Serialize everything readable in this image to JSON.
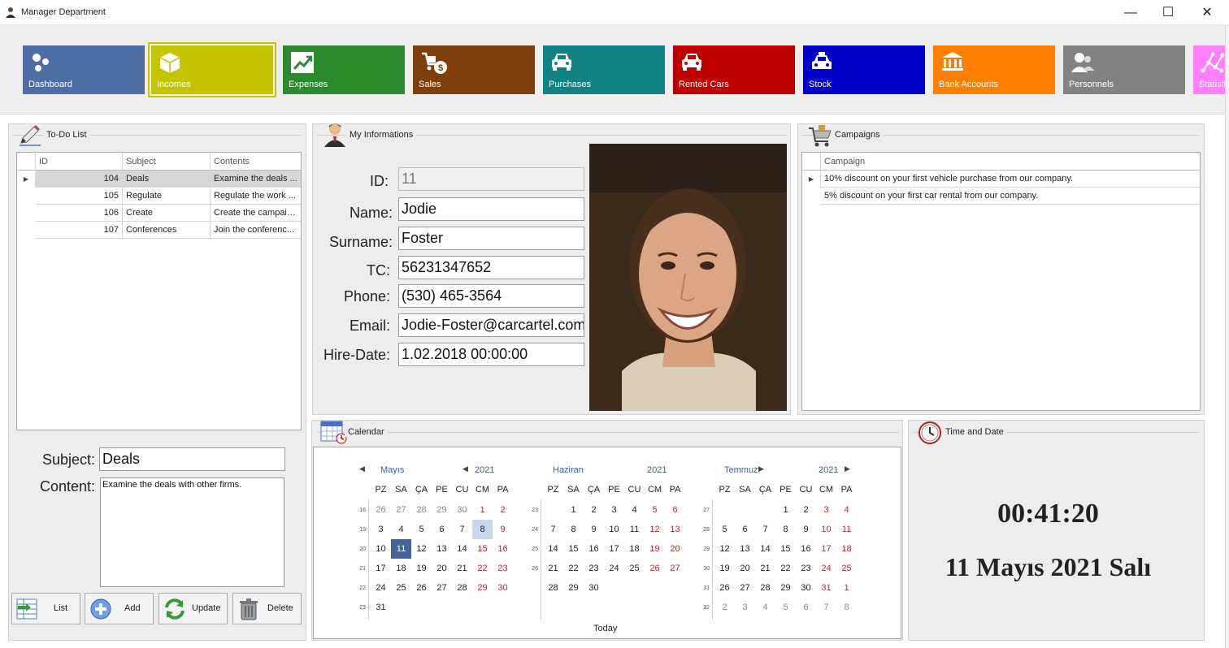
{
  "window": {
    "title": "Manager Department",
    "minimize": "—",
    "maximize": "☐",
    "close": "✕"
  },
  "ribbon": {
    "tiles": [
      {
        "label": "Dashboard",
        "color": "#4e6fa5",
        "icon": "dashboard-icon"
      },
      {
        "label": "Incomes",
        "color": "#c4c400",
        "icon": "box-icon"
      },
      {
        "label": "Expenses",
        "color": "#2b8a2b",
        "icon": "trend-icon"
      },
      {
        "label": "Sales",
        "color": "#7f3f0c",
        "icon": "cart-dollar-icon"
      },
      {
        "label": "Purchases",
        "color": "#0f8383",
        "icon": "car-icon"
      },
      {
        "label": "Rented Cars",
        "color": "#c00000",
        "icon": "car-icon"
      },
      {
        "label": "Stock",
        "color": "#0000c8",
        "icon": "taxi-icon"
      },
      {
        "label": "Bank Accounts",
        "color": "#ff8000",
        "icon": "bank-icon"
      },
      {
        "label": "Personnels",
        "color": "#828282",
        "icon": "users-icon"
      },
      {
        "label": "Statistics",
        "color": "#ff80ff",
        "icon": "network-icon"
      }
    ]
  },
  "todo": {
    "title": "To-Do List",
    "columns": [
      "ID",
      "Subject",
      "Contents"
    ],
    "rows": [
      {
        "id": "104",
        "subject": "Deals",
        "contents": "Examine the deals ..."
      },
      {
        "id": "105",
        "subject": "Regulate",
        "contents": "Regulate the work ..."
      },
      {
        "id": "106",
        "subject": "Create",
        "contents": "Create the campaig..."
      },
      {
        "id": "107",
        "subject": "Conferences",
        "contents": "Join the conferenc..."
      }
    ],
    "subject_label": "Subject:",
    "subject_value": "Deals",
    "content_label": "Content:",
    "content_value": "Examine the deals with other firms.",
    "buttons": {
      "list": "List",
      "add": "Add",
      "update": "Update",
      "delete": "Delete"
    }
  },
  "info": {
    "title": "My Informations",
    "fields": [
      {
        "label": "ID:",
        "value": "11"
      },
      {
        "label": "Name:",
        "value": "Jodie"
      },
      {
        "label": "Surname:",
        "value": "Foster"
      },
      {
        "label": "TC:",
        "value": "56231347652"
      },
      {
        "label": "Phone:",
        "value": "(530) 465-3564"
      },
      {
        "label": "Email:",
        "value": "Jodie-Foster@carcartel.com"
      },
      {
        "label": "Hire-Date:",
        "value": "1.02.2018 00:00:00"
      }
    ]
  },
  "campaigns": {
    "title": "Campaigns",
    "column": "Campaign",
    "rows": [
      "10% discount on your first vehicle purchase from our company.",
      "5% discount on your first car rental from our company."
    ]
  },
  "calendar": {
    "title": "Calendar",
    "today": "Today",
    "dow": [
      "PZ",
      "SA",
      "ÇA",
      "PE",
      "CU",
      "CM",
      "PA"
    ],
    "months": [
      {
        "name": "Mayıs",
        "year": "2021",
        "weeks": [
          "18",
          "19",
          "20",
          "21",
          "22",
          "23"
        ],
        "days": [
          [
            "26",
            "27",
            "28",
            "29",
            "30",
            "1",
            "2"
          ],
          [
            "3",
            "4",
            "5",
            "6",
            "7",
            "8",
            "9"
          ],
          [
            "10",
            "11",
            "12",
            "13",
            "14",
            "15",
            "16"
          ],
          [
            "17",
            "18",
            "19",
            "20",
            "21",
            "22",
            "23"
          ],
          [
            "24",
            "25",
            "26",
            "27",
            "28",
            "29",
            "30"
          ],
          [
            "31",
            "",
            "",
            "",
            "",
            "",
            ""
          ]
        ]
      },
      {
        "name": "Haziran",
        "year": "2021",
        "weeks": [
          "23",
          "24",
          "25",
          "26"
        ],
        "days": [
          [
            "",
            "1",
            "2",
            "3",
            "4",
            "5",
            "6"
          ],
          [
            "7",
            "8",
            "9",
            "10",
            "11",
            "12",
            "13"
          ],
          [
            "14",
            "15",
            "16",
            "17",
            "18",
            "19",
            "20"
          ],
          [
            "21",
            "22",
            "23",
            "24",
            "25",
            "26",
            "27"
          ],
          [
            "28",
            "29",
            "30",
            "",
            "",
            "",
            ""
          ]
        ]
      },
      {
        "name": "Temmuz",
        "year": "2021",
        "weeks": [
          "27",
          "28",
          "29",
          "30",
          "31",
          "32"
        ],
        "days": [
          [
            "",
            "",
            "",
            "1",
            "2",
            "3",
            "4"
          ],
          [
            "5",
            "6",
            "7",
            "8",
            "9",
            "10",
            "11"
          ],
          [
            "12",
            "13",
            "14",
            "15",
            "16",
            "17",
            "18"
          ],
          [
            "19",
            "20",
            "21",
            "22",
            "23",
            "24",
            "25"
          ],
          [
            "26",
            "27",
            "28",
            "29",
            "30",
            "31",
            "1"
          ],
          [
            "2",
            "3",
            "4",
            "5",
            "6",
            "7",
            "8"
          ]
        ]
      }
    ]
  },
  "clock": {
    "title": "Time and Date",
    "time": "00:41:20",
    "date": "11 Mayıs 2021 Salı"
  }
}
